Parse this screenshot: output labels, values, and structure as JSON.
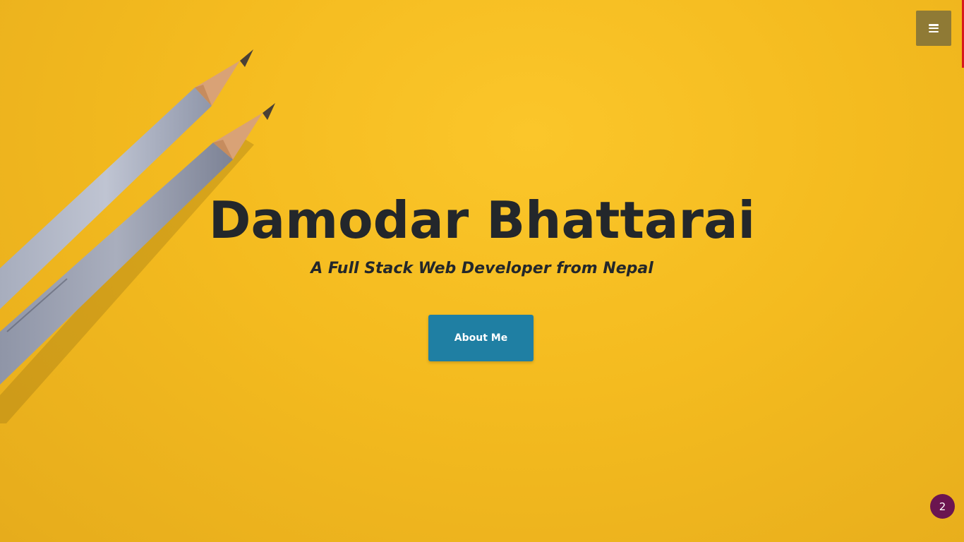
{
  "hero": {
    "title": "Damodar Bhattarai",
    "subtitle": "A Full Stack Web Developer from Nepal",
    "cta_label": "About Me"
  },
  "nav": {
    "menu_icon": "hamburger-menu-icon"
  },
  "notification_badge": {
    "count": "2"
  },
  "colors": {
    "background": "#f6bd20",
    "text": "#23272b",
    "cta_background": "#1f7fa3",
    "menu_button": "#8f7a35",
    "badge": "#6b1550",
    "scroll_indicator": "#d8191e"
  }
}
